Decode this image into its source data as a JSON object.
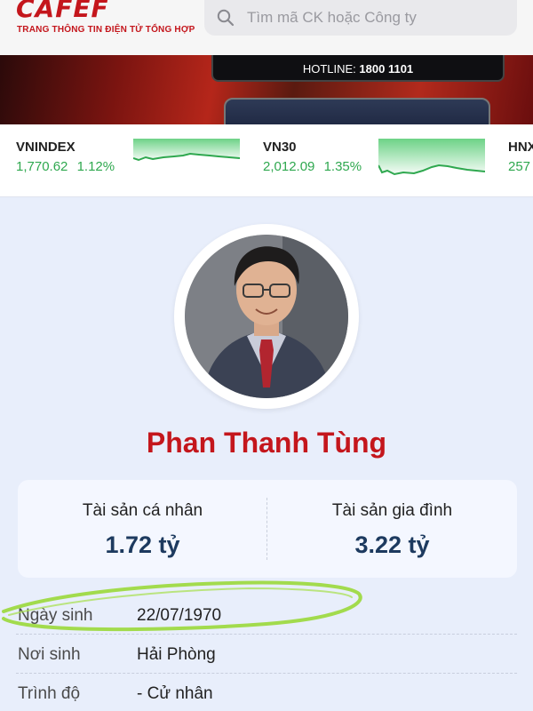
{
  "header": {
    "logo_text": "CAFEF",
    "logo_tagline": "TRANG THÔNG TIN ĐIỆN TỬ TỔNG HỢP",
    "search_placeholder": "Tìm mã CK hoặc Công ty",
    "icons": {
      "search": "search-icon"
    }
  },
  "banner": {
    "hotline_label": "HOTLINE:",
    "hotline_number": "1800 1101"
  },
  "ticker": [
    {
      "name": "VNINDEX",
      "value": "1,770.62",
      "change": "1.12%"
    },
    {
      "name": "VN30",
      "value": "2,012.09",
      "change": "1.35%"
    },
    {
      "name": "HNX",
      "value": "257"
    }
  ],
  "colors": {
    "brand": "#c4161c",
    "up": "#2fa84f",
    "asset_value": "#1d3a5f",
    "highlight": "#9ad83a"
  },
  "profile": {
    "name": "Phan Thanh Tùng",
    "personal_assets_label": "Tài sản cá nhân",
    "personal_assets_value": "1.72 tỷ",
    "family_assets_label": "Tài sản gia đình",
    "family_assets_value": "3.22 tỷ",
    "info": [
      {
        "label": "Ngày sinh",
        "value": "22/07/1970"
      },
      {
        "label": "Nơi sinh",
        "value": "Hải Phòng"
      },
      {
        "label": "Trình độ",
        "value": "- Cử nhân"
      }
    ]
  }
}
